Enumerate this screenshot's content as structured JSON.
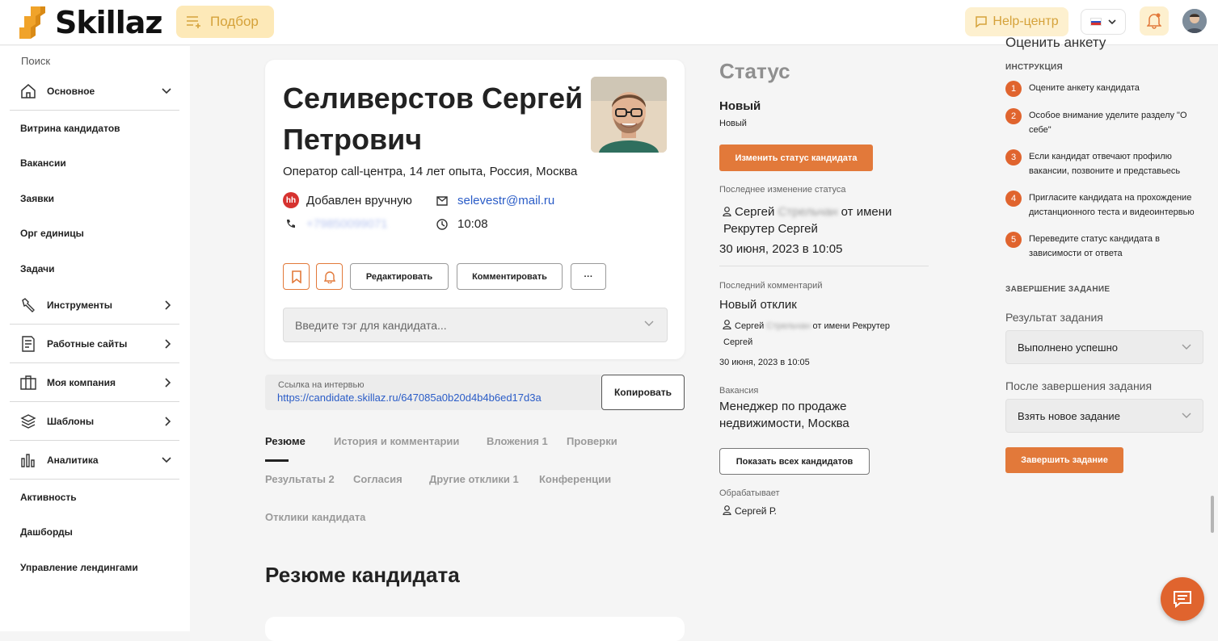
{
  "header": {
    "logo": "Skillaz",
    "podbor": "Подбор",
    "help": "Help-центр"
  },
  "sidebar": {
    "search": "Поиск",
    "osnovnoe": "Основное",
    "vitrina": "Витрина кандидатов",
    "vakansii": "Вакансии",
    "zayavki": "Заявки",
    "org": "Орг единицы",
    "zadachi": "Задачи",
    "instrumenty": "Инструменты",
    "saity": "Работные сайты",
    "kompaniya": "Моя компания",
    "shablony": "Шаблоны",
    "analitika": "Аналитика",
    "aktivnost": "Активность",
    "dashbordy": "Дашборды",
    "lendingi": "Управление лендингами"
  },
  "candidate": {
    "name_line1": "Селиверстов Сергей",
    "name_line2": "Петрович",
    "position": "Оператор call-центра, 14 лет опыта, Россия, Москва",
    "source_badge": "hh",
    "source": "Добавлен вручную",
    "email": "selevestr@mail.ru",
    "phone": "+79850099071",
    "time": "10:08",
    "btn_edit": "Редактировать",
    "btn_comment": "Комментировать",
    "btn_more": "···",
    "tag_placeholder": "Введите тэг для кандидата..."
  },
  "interview": {
    "label": "Ссылка на интервью",
    "url": "https://candidate.skillaz.ru/647085a0b20d4b4b6ed17d3a",
    "copy": "Копировать"
  },
  "tabs": {
    "resume": "Резюме",
    "history": "История и комментарии",
    "attachments": "Вложения 1",
    "checks": "Проверки",
    "results": "Результаты 2",
    "consents": "Согласия",
    "other": "Другие отклики 1",
    "conferences": "Конференции",
    "responses": "Отклики кандидата"
  },
  "resume_title": "Резюме кандидата",
  "status": {
    "title": "Статус",
    "current": "Новый",
    "current_sub": "Новый",
    "change_btn": "Изменить статус кандидата",
    "last_change_lbl": "Последнее изменение статуса",
    "last_change_user": "Сергей",
    "last_change_user_hidden": "Стрельчан",
    "last_change_suffix": "от имени",
    "last_change_line2": "Рекрутер Сергей",
    "last_change_date": "30 июня, 2023 в 10:05",
    "last_comment_lbl": "Последний комментарий",
    "last_comment": "Новый отклик",
    "comment_user": "Сергей",
    "comment_user_hidden": "Стрельчан",
    "comment_suffix": "от имени Рекрутер",
    "comment_line2": "Сергей",
    "comment_date": "30 июня, 2023 в 10:05",
    "vacancy_lbl": "Вакансия",
    "vacancy_line1": "Менеджер по продаже",
    "vacancy_line2": "недвижимости, Москва",
    "show_all_btn": "Показать всех кандидатов",
    "handler_lbl": "Обрабатывает",
    "handler": "Сергей Р."
  },
  "task": {
    "head": "Оценить анкету",
    "instr_lbl": "ИНСТРУКЦИЯ",
    "step1": "Оцените анкету кандидата",
    "step2": "Особое внимание уделите разделу \"О себе\"",
    "step3": "Если кандидат отвечают профилю вакансии, позвоните и представьесь",
    "step4": "Пригласите кандидата на прохождение дистанционного теста и видеоинтервью",
    "step5": "Переведите статус кандидата в зависимости от ответа",
    "finish_lbl": "ЗАВЕРШЕНИЕ ЗАДАНИЕ",
    "result_lbl": "Результат задания",
    "result_val": "Выполнено успешно",
    "after_lbl": "После завершения задания",
    "after_val": "Взять новое задание",
    "finish_btn": "Завершить задание"
  },
  "colors": {
    "accent": "#e2793a",
    "link": "#2a5cc7",
    "podbor_bg": "#fde9b8"
  }
}
